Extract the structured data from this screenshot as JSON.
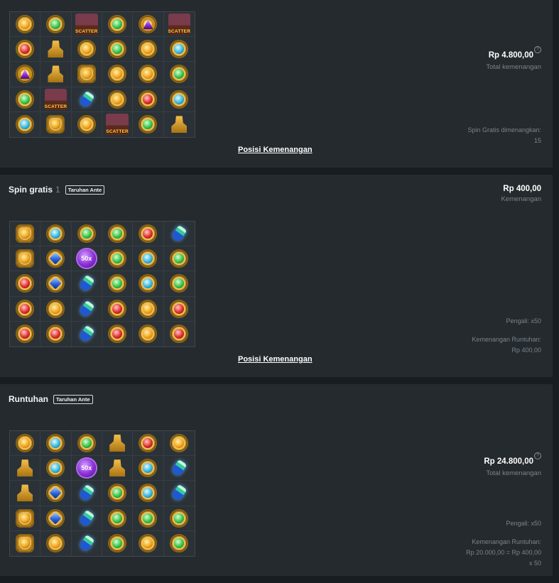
{
  "link_label": "Posisi Kemenangan",
  "panels": [
    {
      "heading": "",
      "spin_number": "",
      "badge": "",
      "amount": "Rp 4.800,00",
      "amount_label": "Total kemenangan",
      "details": [
        "Spin Gratis dimenangkan:",
        "15"
      ],
      "grid": [
        [
          "gem-orange",
          "gem-green",
          "scatter",
          "gem-green",
          "gem-purple",
          "scatter"
        ],
        [
          "gem-red",
          "sphinx",
          "gem-orange",
          "gem-green",
          "gem-orange",
          "gem-cyan"
        ],
        [
          "gem-purple",
          "sphinx",
          "gem-cup",
          "gem-orange",
          "gem-orange",
          "gem-green"
        ],
        [
          "gem-green",
          "scatter",
          "potion",
          "gem-orange",
          "gem-red",
          "gem-cyan"
        ],
        [
          "gem-cyan",
          "gem-cup",
          "gem-orange",
          "scatter",
          "gem-green",
          "sphinx"
        ]
      ]
    },
    {
      "heading": "Spin gratis",
      "spin_number": "1",
      "badge": "Taruhan Ante",
      "amount": "Rp 400,00",
      "amount_label": "Kemenangan",
      "details": [
        "Pengali: x50",
        "",
        "Kemenangan Runtuhan:",
        "Rp 400,00"
      ],
      "grid": [
        [
          "gem-cup",
          "gem-cyan",
          "gem-green",
          "gem-green",
          "gem-red",
          "potion"
        ],
        [
          "gem-cup",
          "gem-blue",
          "mult",
          "gem-green",
          "gem-cyan",
          "gem-green"
        ],
        [
          "gem-red",
          "gem-blue",
          "potion",
          "gem-green",
          "gem-cyan",
          "gem-green"
        ],
        [
          "gem-red",
          "gem-orange",
          "potion",
          "gem-red",
          "gem-orange",
          "gem-red"
        ],
        [
          "gem-red",
          "gem-red",
          "potion",
          "gem-red",
          "gem-orange",
          "gem-red"
        ]
      ]
    },
    {
      "heading": "Runtuhan",
      "spin_number": "",
      "badge": "Taruhan Ante",
      "amount": "Rp 24.800,00",
      "amount_label": "Total kemenangan",
      "details": [
        "Pengali: x50",
        "",
        "Kemenangan Runtuhan:",
        "Rp 20.000,00 = Rp 400,00",
        "x 50"
      ],
      "grid": [
        [
          "gem-orange",
          "gem-cyan",
          "gem-green",
          "sphinx",
          "gem-red",
          "gem-orange"
        ],
        [
          "sphinx",
          "gem-cyan",
          "mult",
          "sphinx",
          "gem-cyan",
          "potion"
        ],
        [
          "sphinx",
          "gem-blue",
          "potion",
          "gem-green",
          "gem-cyan",
          "potion"
        ],
        [
          "gem-cup",
          "gem-blue",
          "potion",
          "gem-green",
          "gem-green",
          "gem-green"
        ],
        [
          "gem-cup",
          "gem-orange",
          "potion",
          "gem-green",
          "gem-orange",
          "gem-green"
        ]
      ]
    }
  ],
  "symbol_labels": {
    "scatter": "SCATTER",
    "mult": "50x"
  },
  "colors": {
    "page_bg": "#181d21",
    "panel_bg": "#242a2e",
    "accent_text": "#ffffff",
    "muted_text": "#7b858b"
  }
}
